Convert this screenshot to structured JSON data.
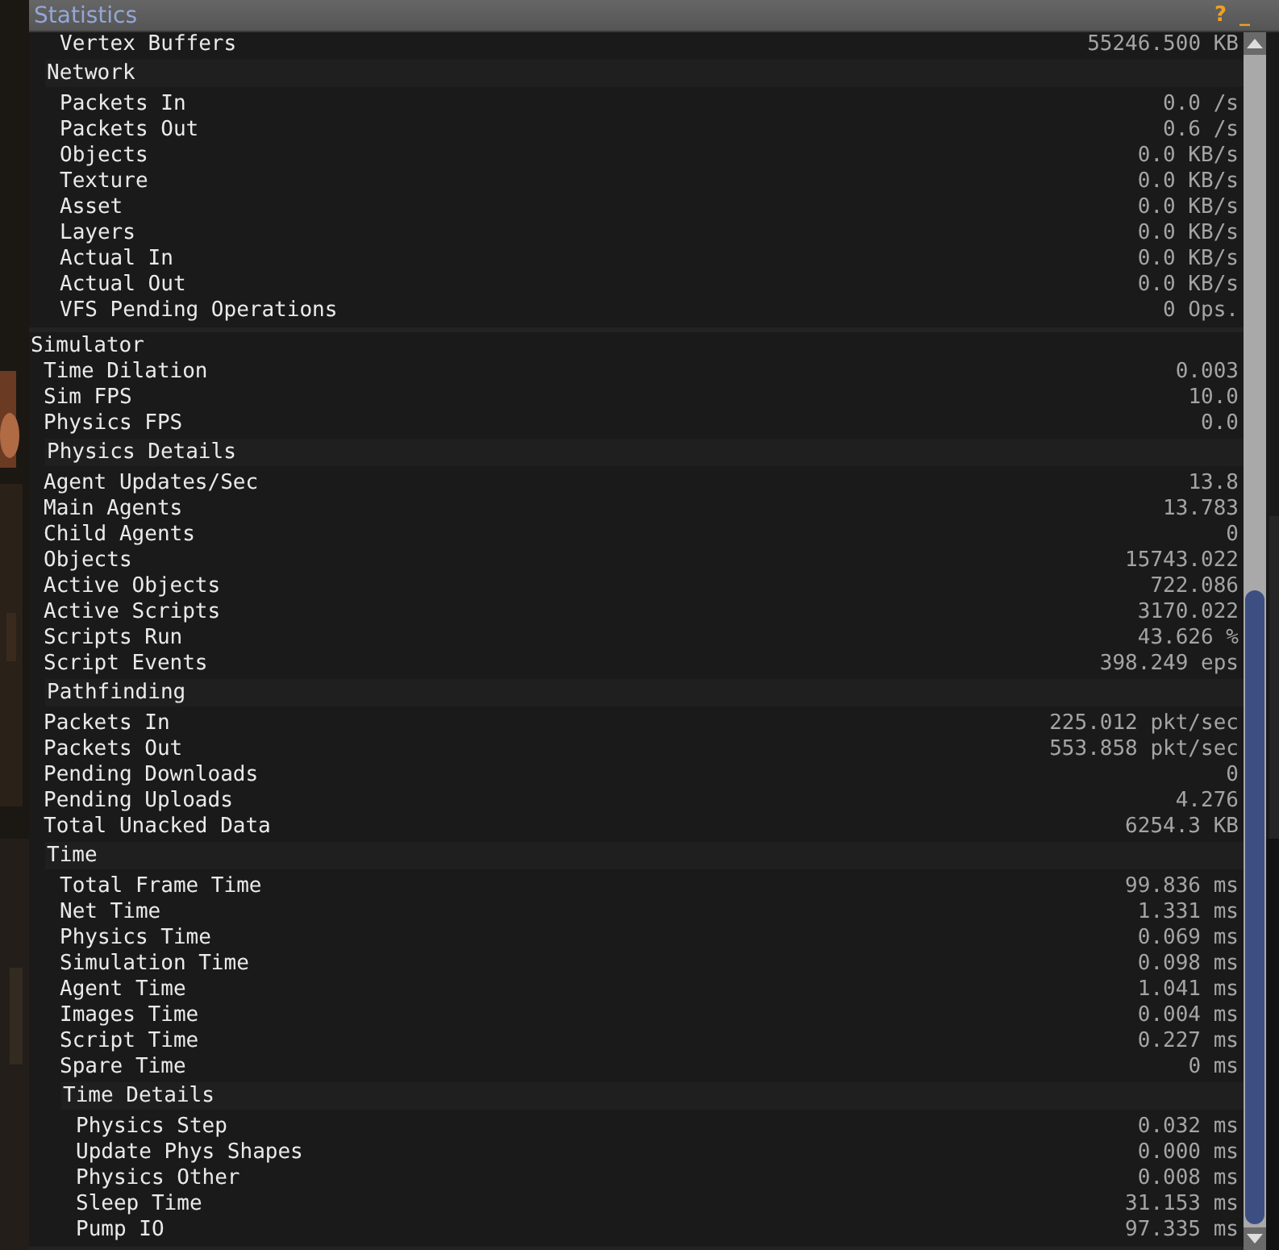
{
  "window": {
    "title": "Statistics",
    "buttons": [
      "?",
      "_"
    ]
  },
  "sections": [
    {
      "children": [
        {
          "kind": "section",
          "children": [
            {
              "kind": "stat",
              "label": "Vertex Buffers",
              "value": "55246.500 KB"
            }
          ]
        },
        {
          "kind": "section",
          "label": "Network",
          "children": [
            {
              "kind": "stat",
              "label": "Packets In",
              "value": "0.0 /s"
            },
            {
              "kind": "stat",
              "label": "Packets Out",
              "value": "0.6 /s"
            },
            {
              "kind": "stat",
              "label": "Objects",
              "value": "0.0 KB/s"
            },
            {
              "kind": "stat",
              "label": "Texture",
              "value": "0.0 KB/s"
            },
            {
              "kind": "stat",
              "label": "Asset",
              "value": "0.0 KB/s"
            },
            {
              "kind": "stat",
              "label": "Layers",
              "value": "0.0 KB/s"
            },
            {
              "kind": "stat",
              "label": "Actual In",
              "value": "0.0 KB/s"
            },
            {
              "kind": "stat",
              "label": "Actual Out",
              "value": "0.0 KB/s"
            },
            {
              "kind": "stat",
              "label": "VFS Pending Operations",
              "value": "0 Ops."
            }
          ]
        }
      ]
    },
    {
      "label": "Simulator",
      "children": [
        {
          "kind": "stat",
          "label": "Time Dilation",
          "value": "0.003"
        },
        {
          "kind": "stat",
          "label": "Sim FPS",
          "value": "10.0"
        },
        {
          "kind": "stat",
          "label": "Physics FPS",
          "value": "0.0"
        },
        {
          "kind": "section",
          "label": "Physics Details"
        },
        {
          "kind": "stat",
          "label": "Agent Updates/Sec",
          "value": "13.8"
        },
        {
          "kind": "stat",
          "label": "Main Agents",
          "value": "13.783"
        },
        {
          "kind": "stat",
          "label": "Child Agents",
          "value": "0"
        },
        {
          "kind": "stat",
          "label": "Objects",
          "value": "15743.022"
        },
        {
          "kind": "stat",
          "label": "Active Objects",
          "value": "722.086"
        },
        {
          "kind": "stat",
          "label": "Active Scripts",
          "value": "3170.022"
        },
        {
          "kind": "stat",
          "label": "Scripts Run",
          "value": "43.626 %"
        },
        {
          "kind": "stat",
          "label": "Script Events",
          "value": "398.249 eps"
        },
        {
          "kind": "section",
          "label": "Pathfinding"
        },
        {
          "kind": "stat",
          "label": "Packets In",
          "value": "225.012 pkt/sec"
        },
        {
          "kind": "stat",
          "label": "Packets Out",
          "value": "553.858 pkt/sec"
        },
        {
          "kind": "stat",
          "label": "Pending Downloads",
          "value": "0"
        },
        {
          "kind": "stat",
          "label": "Pending Uploads",
          "value": "4.276"
        },
        {
          "kind": "stat",
          "label": "Total Unacked Data",
          "value": "6254.3 KB"
        },
        {
          "kind": "section",
          "label": "Time",
          "children": [
            {
              "kind": "stat",
              "label": "Total Frame Time",
              "value": "99.836 ms"
            },
            {
              "kind": "stat",
              "label": "Net Time",
              "value": "1.331 ms"
            },
            {
              "kind": "stat",
              "label": "Physics Time",
              "value": "0.069 ms"
            },
            {
              "kind": "stat",
              "label": "Simulation Time",
              "value": "0.098 ms"
            },
            {
              "kind": "stat",
              "label": "Agent Time",
              "value": "1.041 ms"
            },
            {
              "kind": "stat",
              "label": "Images Time",
              "value": "0.004 ms"
            },
            {
              "kind": "stat",
              "label": "Script Time",
              "value": "0.227 ms"
            },
            {
              "kind": "stat",
              "label": "Spare Time",
              "value": "0 ms"
            },
            {
              "kind": "section",
              "label": "Time Details",
              "children": [
                {
                  "kind": "stat",
                  "label": "Physics Step",
                  "value": "0.032 ms"
                },
                {
                  "kind": "stat",
                  "label": "Update Phys Shapes",
                  "value": "0.000 ms"
                },
                {
                  "kind": "stat",
                  "label": "Physics Other",
                  "value": "0.008 ms"
                },
                {
                  "kind": "stat",
                  "label": "Sleep Time",
                  "value": "31.153 ms"
                },
                {
                  "kind": "stat",
                  "label": "Pump IO",
                  "value": "97.335 ms"
                }
              ]
            }
          ]
        }
      ]
    }
  ]
}
